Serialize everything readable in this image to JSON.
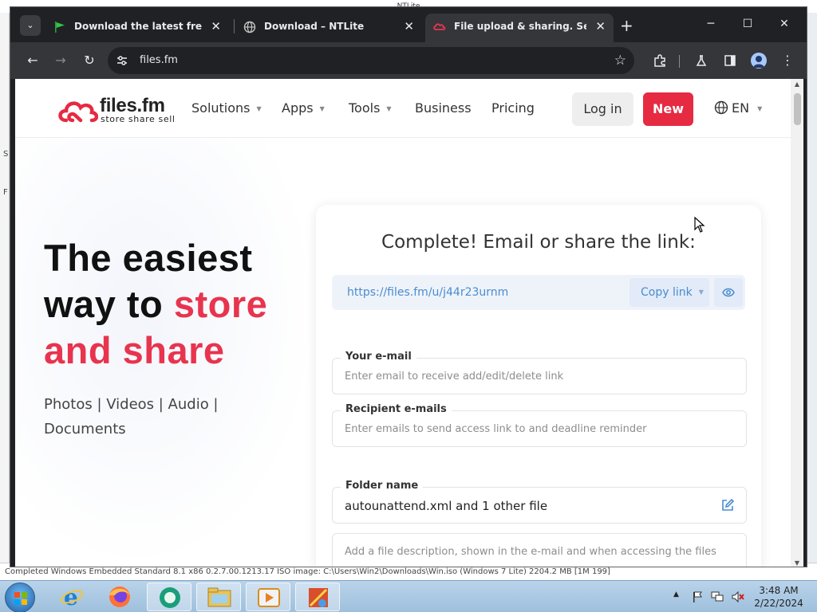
{
  "background_window": {
    "title": "NTLite",
    "left_marks": [
      "S",
      "F"
    ],
    "status_text": "Completed   Windows Embedded Standard 8.1 x86     0.2.7.00.1213.17    ISO image: C:\\Users\\Win2\\Downloads\\Win.iso (Windows 7 Lite) 2204.2 MB [1M 199]"
  },
  "browser": {
    "tabs": [
      {
        "title": "Download the latest free trial v",
        "icon": "green-flag-icon",
        "active": false
      },
      {
        "title": "Download – NTLite",
        "icon": "globe-icon",
        "active": false
      },
      {
        "title": "File upload & sharing. Send lar",
        "icon": "filesfm-cloud-icon",
        "active": true
      }
    ],
    "new_tab_label": "+",
    "url": "files.fm",
    "window_controls": [
      "minimize",
      "maximize",
      "close"
    ]
  },
  "site": {
    "brand": "files.fm",
    "tagline": "store  share  sell",
    "nav": [
      {
        "label": "Solutions",
        "dropdown": true
      },
      {
        "label": "Apps",
        "dropdown": true
      },
      {
        "label": "Tools",
        "dropdown": true
      },
      {
        "label": "Business",
        "dropdown": false
      },
      {
        "label": "Pricing",
        "dropdown": false
      }
    ],
    "login_label": "Log in",
    "new_label": "New",
    "language": "EN",
    "colors": {
      "accent": "#e62a42",
      "link": "#4a8ccf",
      "title_red": "#e8344e"
    }
  },
  "hero": {
    "line1": "The easiest",
    "line2_black": "way to ",
    "line2_red": "store",
    "line3_red": "and share",
    "subtitle": "Photos | Videos | Audio | Documents"
  },
  "card": {
    "title": "Complete! Email or share the link:",
    "share_link": "https://files.fm/u/j44r23urnm",
    "copy_label": "Copy link",
    "your_email": {
      "label": "Your e-mail",
      "placeholder": "Enter email to receive add/edit/delete link"
    },
    "recipients": {
      "label": "Recipient e-mails",
      "placeholder": "Enter emails to send access link to and deadline reminder"
    },
    "folder": {
      "label": "Folder name",
      "value": "autounattend.xml and 1 other file"
    },
    "description": {
      "placeholder": "Add a file description, shown in the e-mail and when accessing the files"
    }
  },
  "taskbar": {
    "apps": [
      "internet-explorer-icon",
      "firefox-icon",
      "chat-bubble-icon",
      "file-explorer-icon",
      "media-player-icon",
      "ntlite-icon"
    ],
    "time": "3:48 AM",
    "date": "2/22/2024"
  }
}
